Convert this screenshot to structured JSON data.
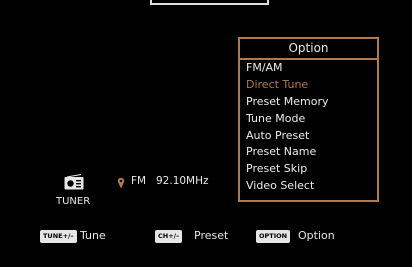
{
  "source": {
    "label": "TUNER",
    "icon": "radio-icon"
  },
  "station": {
    "band": "FM",
    "frequency": "92.10MHz",
    "icon": "antenna-pin-icon"
  },
  "option_menu": {
    "title": "Option",
    "items": [
      {
        "label": "FM/AM",
        "selected": false
      },
      {
        "label": "Direct Tune",
        "selected": true
      },
      {
        "label": "Preset Memory",
        "selected": false
      },
      {
        "label": "Tune Mode",
        "selected": false
      },
      {
        "label": "Auto Preset",
        "selected": false
      },
      {
        "label": "Preset Name",
        "selected": false
      },
      {
        "label": "Preset Skip",
        "selected": false
      },
      {
        "label": "Video Select",
        "selected": false
      }
    ]
  },
  "footer": [
    {
      "key": "TUNE+/–",
      "label": "Tune"
    },
    {
      "key": "CH+/–",
      "label": "Preset"
    },
    {
      "key": "OPTION",
      "label": "Option"
    }
  ],
  "colors": {
    "background": "#000000",
    "accent": "#b07a4c",
    "text": "#ececec"
  }
}
